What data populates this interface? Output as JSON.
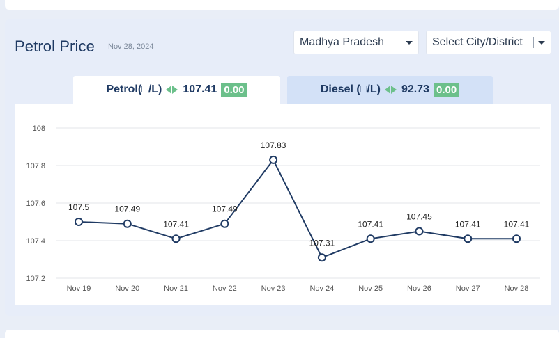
{
  "page": {
    "title": "Petrol Price",
    "date": "Nov 28, 2024"
  },
  "selects": {
    "state": "Madhya Pradesh",
    "city": "Select City/District"
  },
  "tabs": {
    "petrol": {
      "label": "Petrol(□/L)",
      "price": "107.41",
      "change": "0.00"
    },
    "diesel": {
      "label": "Diesel (□/L)",
      "price": "92.73",
      "change": "0.00"
    }
  },
  "colors": {
    "line": "#1f3a63",
    "change_badge": "#6cc08b",
    "grid": "#e3e6ea"
  },
  "chart_data": {
    "type": "line",
    "categories": [
      "Nov 19",
      "Nov 20",
      "Nov 21",
      "Nov 22",
      "Nov 23",
      "Nov 24",
      "Nov 25",
      "Nov 26",
      "Nov 27",
      "Nov 28"
    ],
    "series": [
      {
        "values": [
          107.5,
          107.49,
          107.41,
          107.49,
          107.83,
          107.31,
          107.41,
          107.45,
          107.41,
          107.41
        ],
        "labels": [
          "107.5",
          "107.49",
          "107.41",
          "107.49",
          "107.83",
          "107.31",
          "107.41",
          "107.45",
          "107.41",
          "107.41"
        ]
      }
    ],
    "yticks": [
      "107.2",
      "107.4",
      "107.6",
      "107.8",
      "108"
    ],
    "ylim": [
      107.2,
      108
    ],
    "grid": true,
    "legend": false
  }
}
